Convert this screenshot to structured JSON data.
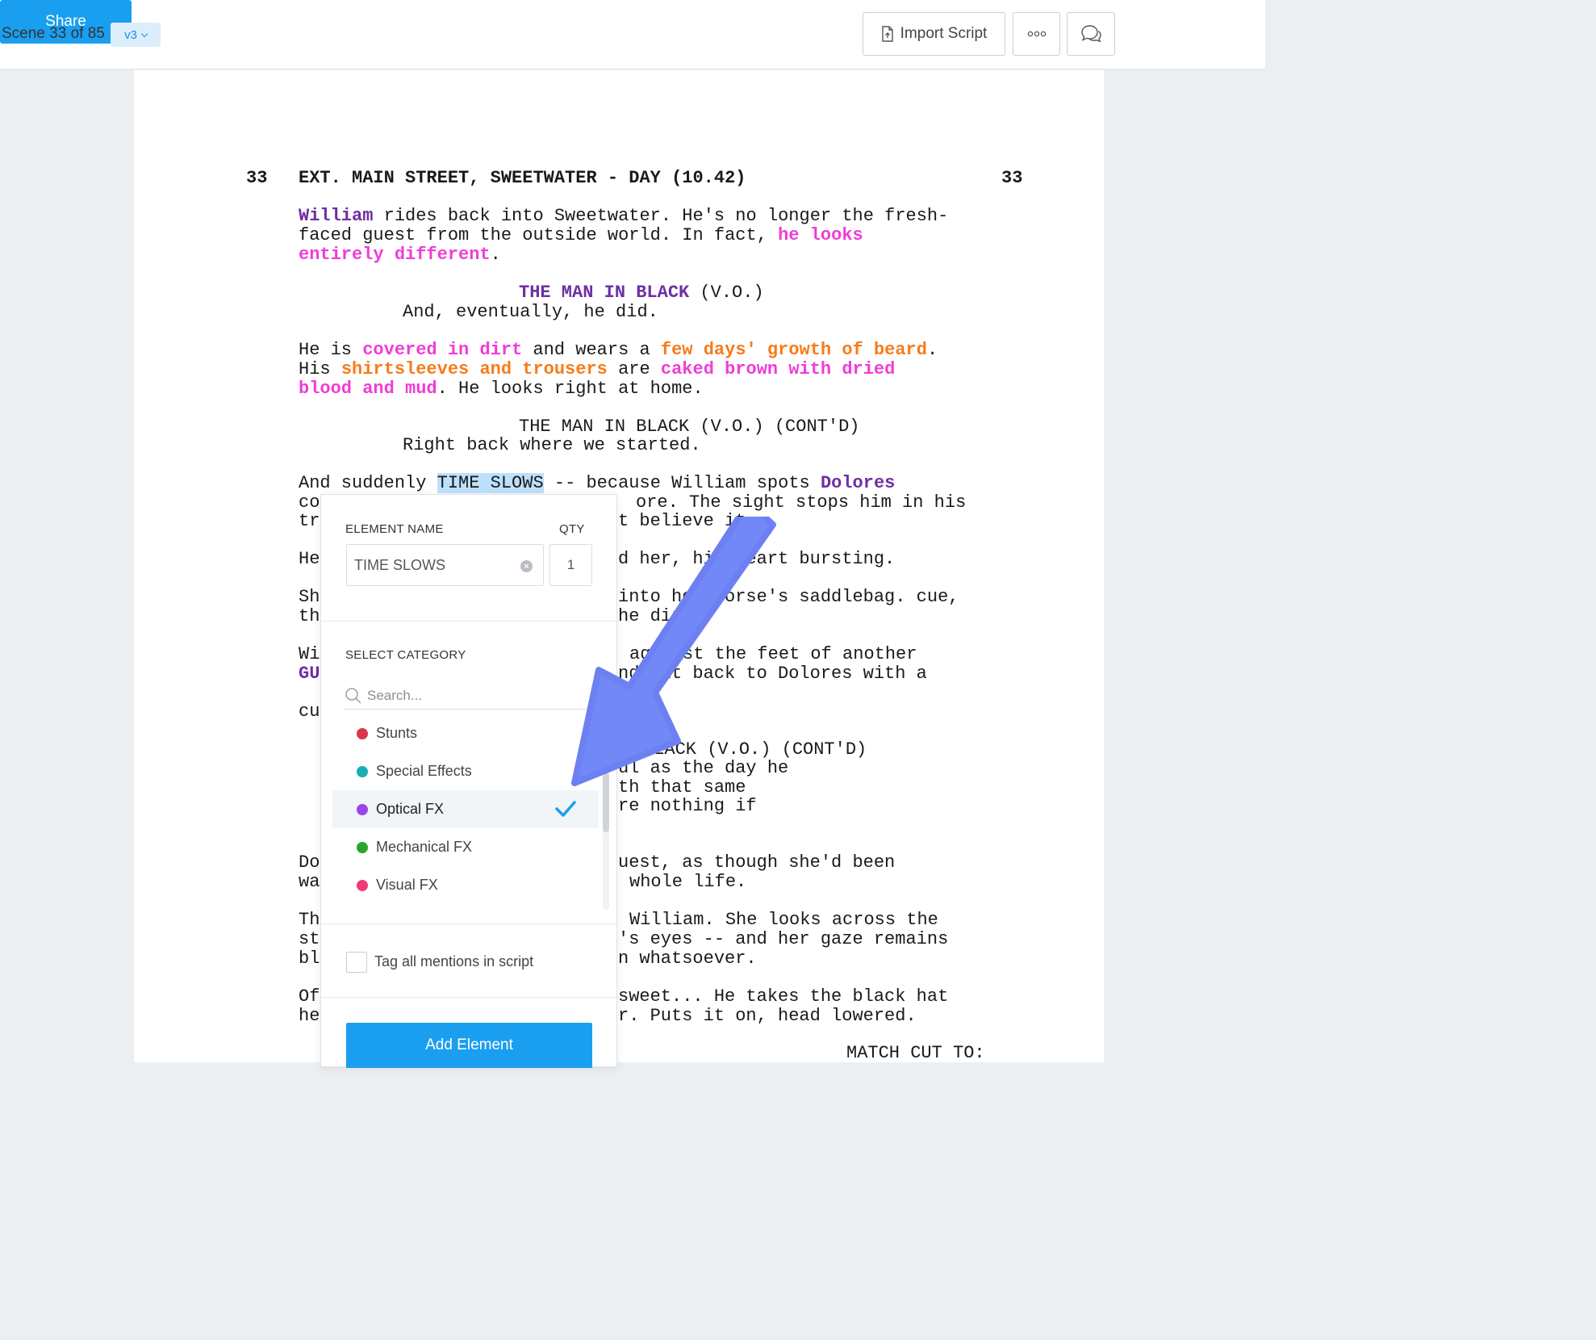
{
  "header": {
    "scene_label": "Scene 33 of 85",
    "version": "v3",
    "import_label": "Import Script",
    "more_label": "°°°",
    "share_label": "Share"
  },
  "script": {
    "scene_number_left": "33",
    "scene_heading": "EXT. MAIN STREET, SWEETWATER - DAY (10.42)",
    "scene_number_right": "33",
    "p1_l1_a": "William",
    "p1_l1_b": " rides back into Sweetwater. He's no longer the fresh-",
    "p1_l2_a": "faced guest from the outside world. In fact, ",
    "p1_l2_b": "he looks",
    "p1_l3_a": "entirely different",
    "p1_l3_b": ".",
    "c1_name": "THE MAN IN BLACK",
    "c1_ext": " (V.O.)",
    "c1_line": "And, eventually, he did.",
    "p2_l1_a": "He is ",
    "p2_l1_b": "covered in dirt",
    "p2_l1_c": " and wears a ",
    "p2_l1_d": "few days' growth of beard",
    "p2_l1_e": ".",
    "p2_l2_a": "His ",
    "p2_l2_b": "shirtsleeves and trousers",
    "p2_l2_c": " are ",
    "p2_l2_d": "caked brown with dried",
    "p2_l3_a": "blood and mud",
    "p2_l3_b": ". He looks right at home.",
    "c2_name": "THE MAN IN BLACK (V.O.) (CONT'D)",
    "c2_line": "Right back where we started.",
    "p3_l1_a": "And suddenly ",
    "p3_l1_b": "TIME SLOWS",
    "p3_l1_c": " -- because William spots ",
    "p3_l1_d": "Dolores",
    "p3_l2_a": "co",
    "p3_l2_b": "ore. The sight stops him in his",
    "p3_l3_a": "tr",
    "p3_l3_b": "t believe it.",
    "p4_l1_a": "He",
    "p4_l1_b": "d her, his heart bursting.",
    "p5_l1_a": "Sh",
    "p5_l1_b": "into her horse's saddlebag. cue,",
    "p5_l2_a": "th",
    "p5_l2_b": "he dirt",
    "p6_l1_a": "Wi",
    "p6_l1_b": "against the feet of another",
    "p6_l2_a": "GU",
    "p6_l2_b": "nds it back to Dolores with a",
    "p6_l3_a": "cu",
    "c3_name": "BLACK (V.O.) (CONT'D)",
    "c3_l1": "ul as the day he",
    "c3_l2": "th that same",
    "c3_l3": "re nothing if",
    "p7_l1_a": "Do",
    "p7_l1_b": "uest, as though she'd been",
    "p7_l2_a": "wa",
    "p7_l2_b": "whole life.",
    "p8_l1_a": "Th",
    "p8_l1_b": "William. She looks across the",
    "p8_l2_a": "st",
    "p8_l2_b": "'s eyes -- and her gaze remains",
    "p8_l3_a": "bl",
    "p8_l3_b": "n whatsoever.",
    "p9_l1_a": "Of",
    "p9_l1_b": "sweet... He takes the black hat",
    "p9_l2_a": "he",
    "p9_l2_b": "r. Puts it on, head lowered.",
    "transition": "MATCH CUT TO:"
  },
  "popup": {
    "element_name_label": "ELEMENT NAME",
    "qty_label": "QTY",
    "element_name_value": "TIME SLOWS",
    "qty_value": "1",
    "select_category_label": "SELECT CATEGORY",
    "search_placeholder": "Search...",
    "categories": [
      {
        "label": "Stunts",
        "color": "#d9364b"
      },
      {
        "label": "Special Effects",
        "color": "#1aaeb3"
      },
      {
        "label": "Optical FX",
        "color": "#9b44e8",
        "selected": true
      },
      {
        "label": "Mechanical FX",
        "color": "#2aa52a"
      },
      {
        "label": "Visual FX",
        "color": "#f03b7a"
      }
    ],
    "tag_all_label": "Tag all mentions in script",
    "add_button_label": "Add Element"
  },
  "colors": {
    "accent": "#1a9ef0",
    "character": "#6d2fa3",
    "tag_pink": "#f03cd6",
    "tag_orange": "#f77b18",
    "arrow": "#7388f7"
  }
}
